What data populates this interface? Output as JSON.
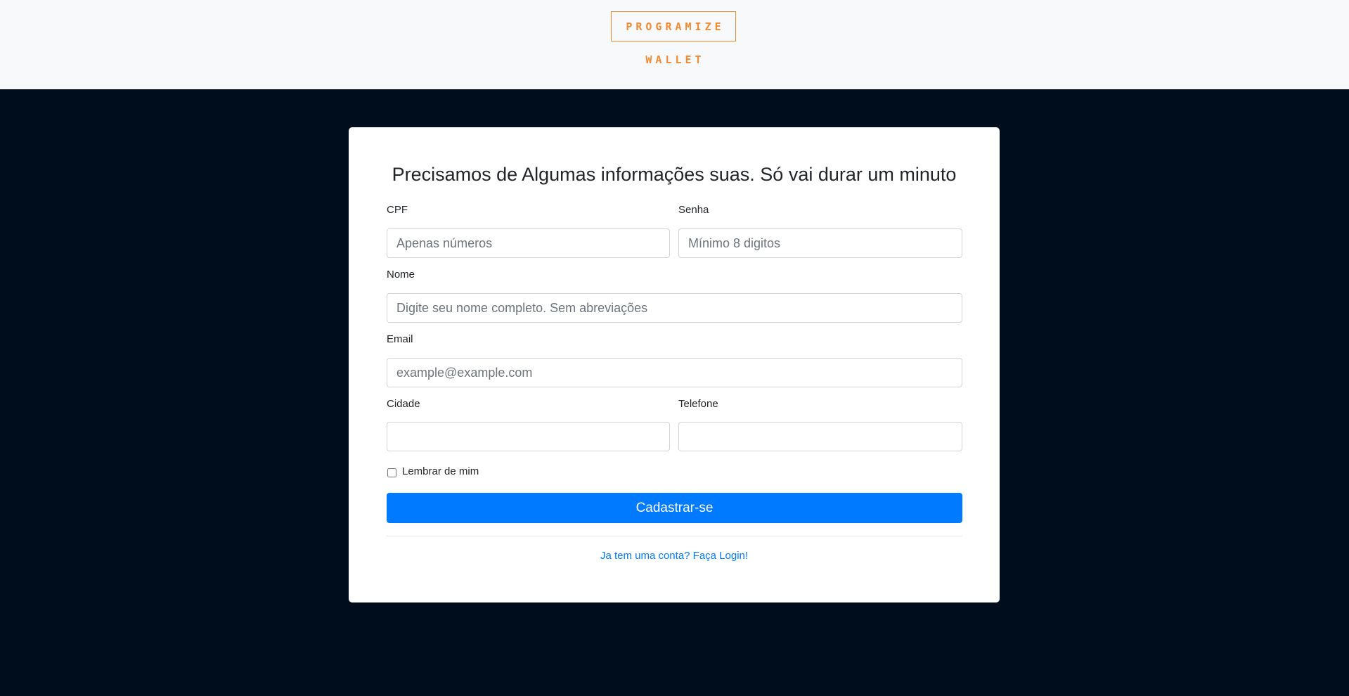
{
  "brand": {
    "name": "PROGRAMIZE",
    "sub": "WALLET",
    "color": "#f08a33"
  },
  "form": {
    "title": "Precisamos de Algumas informações suas. Só vai durar um minuto",
    "fields": {
      "cpf": {
        "label": "CPF",
        "placeholder": "Apenas números",
        "value": ""
      },
      "senha": {
        "label": "Senha",
        "placeholder": "Mínimo 8 digitos",
        "value": ""
      },
      "nome": {
        "label": "Nome",
        "placeholder": "Digite seu nome completo. Sem abreviações",
        "value": ""
      },
      "email": {
        "label": "Email",
        "placeholder": "example@example.com",
        "value": ""
      },
      "cidade": {
        "label": "Cidade",
        "placeholder": "",
        "value": ""
      },
      "telefone": {
        "label": "Telefone",
        "placeholder": "",
        "value": ""
      }
    },
    "remember": {
      "label": "Lembrar de mim",
      "checked": false
    },
    "submit_label": "Cadastrar-se",
    "login_link": "Ja tem uma conta? Faça Login",
    "login_suffix": "!"
  },
  "colors": {
    "background": "#000d1d",
    "header": "#f8f9fa",
    "primary": "#007bff"
  }
}
